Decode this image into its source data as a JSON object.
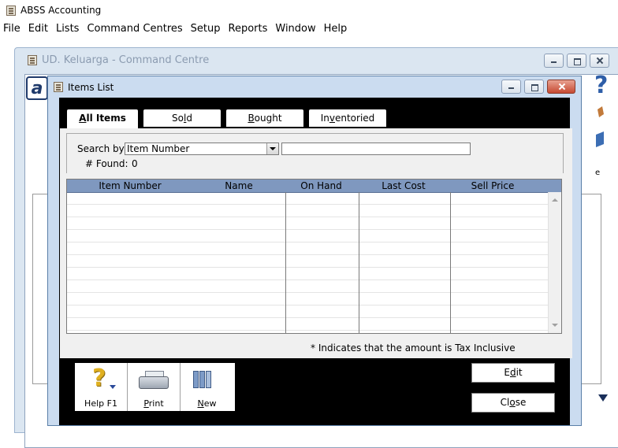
{
  "app": {
    "title": "ABSS Accounting"
  },
  "menu": [
    "File",
    "Edit",
    "Lists",
    "Command Centres",
    "Setup",
    "Reports",
    "Window",
    "Help"
  ],
  "command_centre": {
    "title": "UD. Keluarga - Command Centre",
    "side_letter": "e"
  },
  "items_list": {
    "title": "Items List",
    "tabs": [
      {
        "pre": "",
        "key": "A",
        "post": "ll Items",
        "active": true
      },
      {
        "pre": "So",
        "key": "l",
        "post": "d",
        "active": false
      },
      {
        "pre": "",
        "key": "B",
        "post": "ought",
        "active": false
      },
      {
        "pre": "In",
        "key": "v",
        "post": "entoried",
        "active": false
      }
    ],
    "search_by_label": "Search by:",
    "search_by_value": "Item Number",
    "search_text": "",
    "found_label": "# Found:",
    "found_count": "0",
    "columns": [
      "Item Number",
      "Name",
      "On Hand",
      "Last Cost",
      "Sell Price"
    ],
    "rows": [],
    "footnote": "* Indicates that the amount is Tax Inclusive",
    "toolbar": {
      "help": {
        "label": "Help F1"
      },
      "print": {
        "pre": "",
        "key": "P",
        "post": "rint"
      },
      "new": {
        "pre": "",
        "key": "N",
        "post": "ew"
      }
    },
    "edit_button": {
      "pre": "E",
      "key": "d",
      "post": "it"
    },
    "close_button": {
      "pre": "Cl",
      "key": "o",
      "post": "se"
    }
  }
}
